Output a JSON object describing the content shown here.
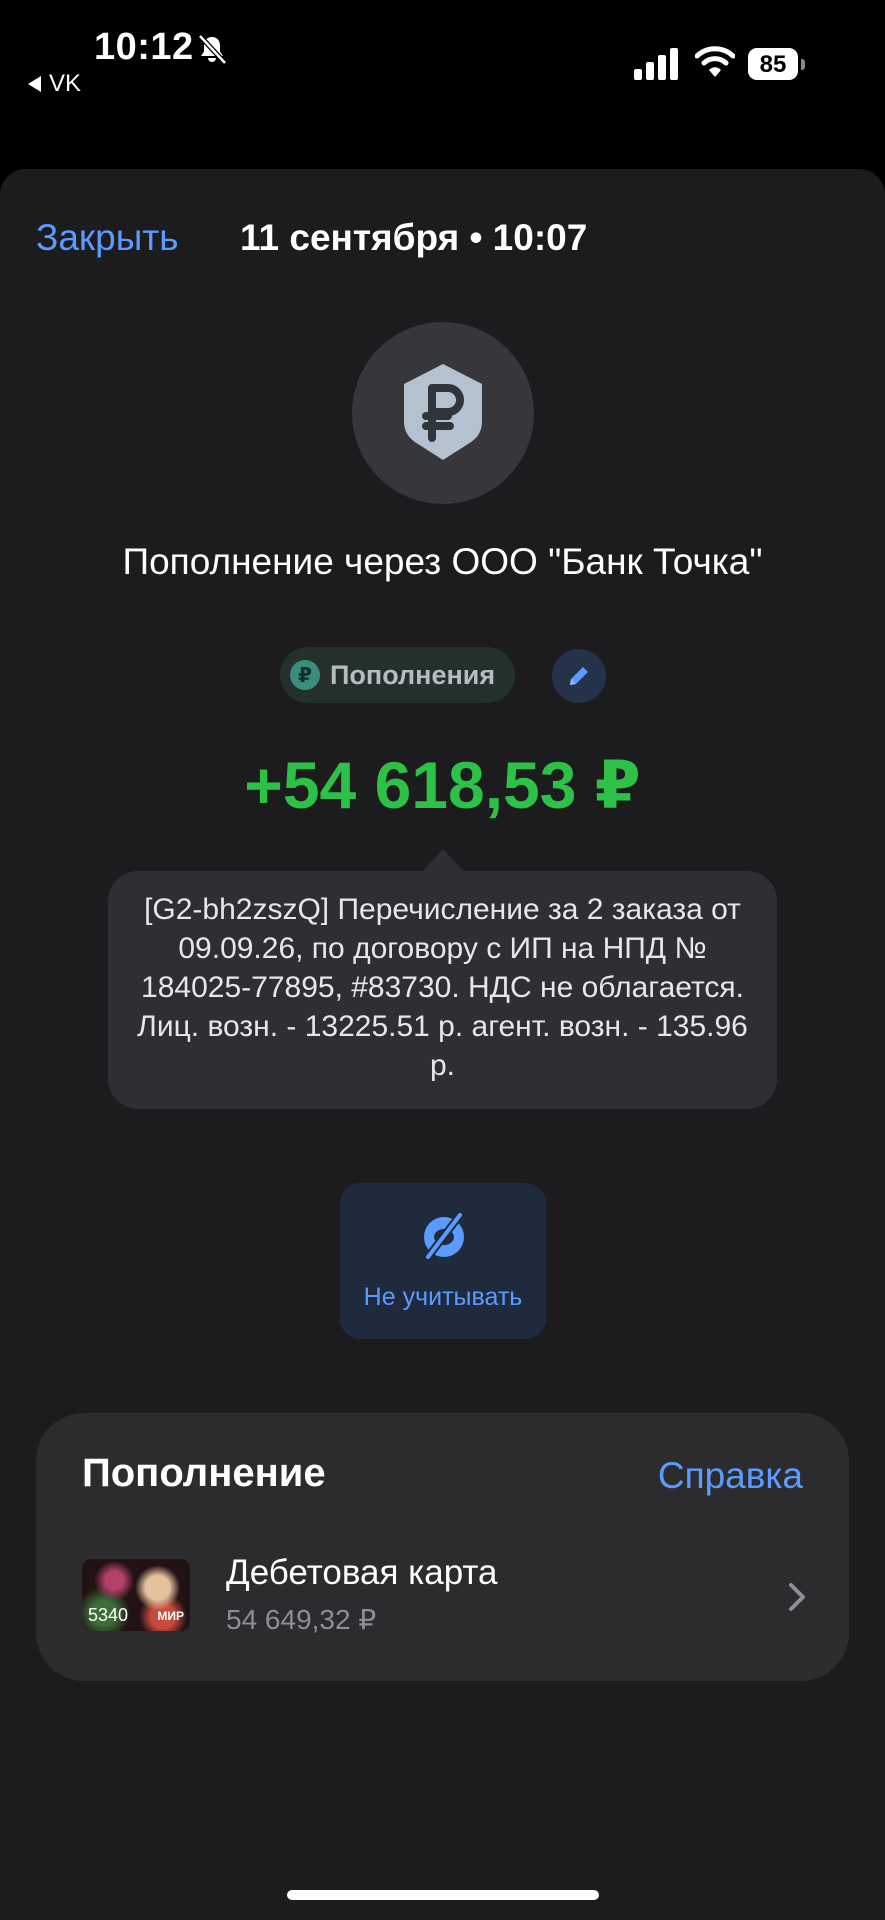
{
  "status_bar": {
    "time": "10:12",
    "back_app": "VK",
    "battery": "85"
  },
  "header": {
    "close_label": "Закрыть",
    "title": "11 сентября • 10:07"
  },
  "operation": {
    "avatar_icon": "ruble-icon",
    "title": "Пополнение через ООО \"Банк Точка\"",
    "category_label": "Пополнения",
    "category_icon_glyph": "₽",
    "amount": "+54 618,53 ₽",
    "description": "[G2-bh2zszQ] Перечисление за 2 заказа от 09.09.26, по договору с ИП на НПД № 184025-77895, #83730. НДС не облагается. Лиц. возн. - 13225.51 р. агент. возн. - 135.96 р.",
    "ignore_label": "Не учитывать"
  },
  "details_card": {
    "title": "Пополнение",
    "help_label": "Справка",
    "account": {
      "card_number": "5340",
      "card_system": "МИР",
      "name": "Дебетовая карта",
      "balance": "54 649,32 ₽"
    }
  },
  "colors": {
    "accent_blue": "#5b9bff",
    "amount_green": "#2ec147",
    "sheet_bg": "#1c1c1e",
    "card_bg": "#2c2c2e"
  }
}
